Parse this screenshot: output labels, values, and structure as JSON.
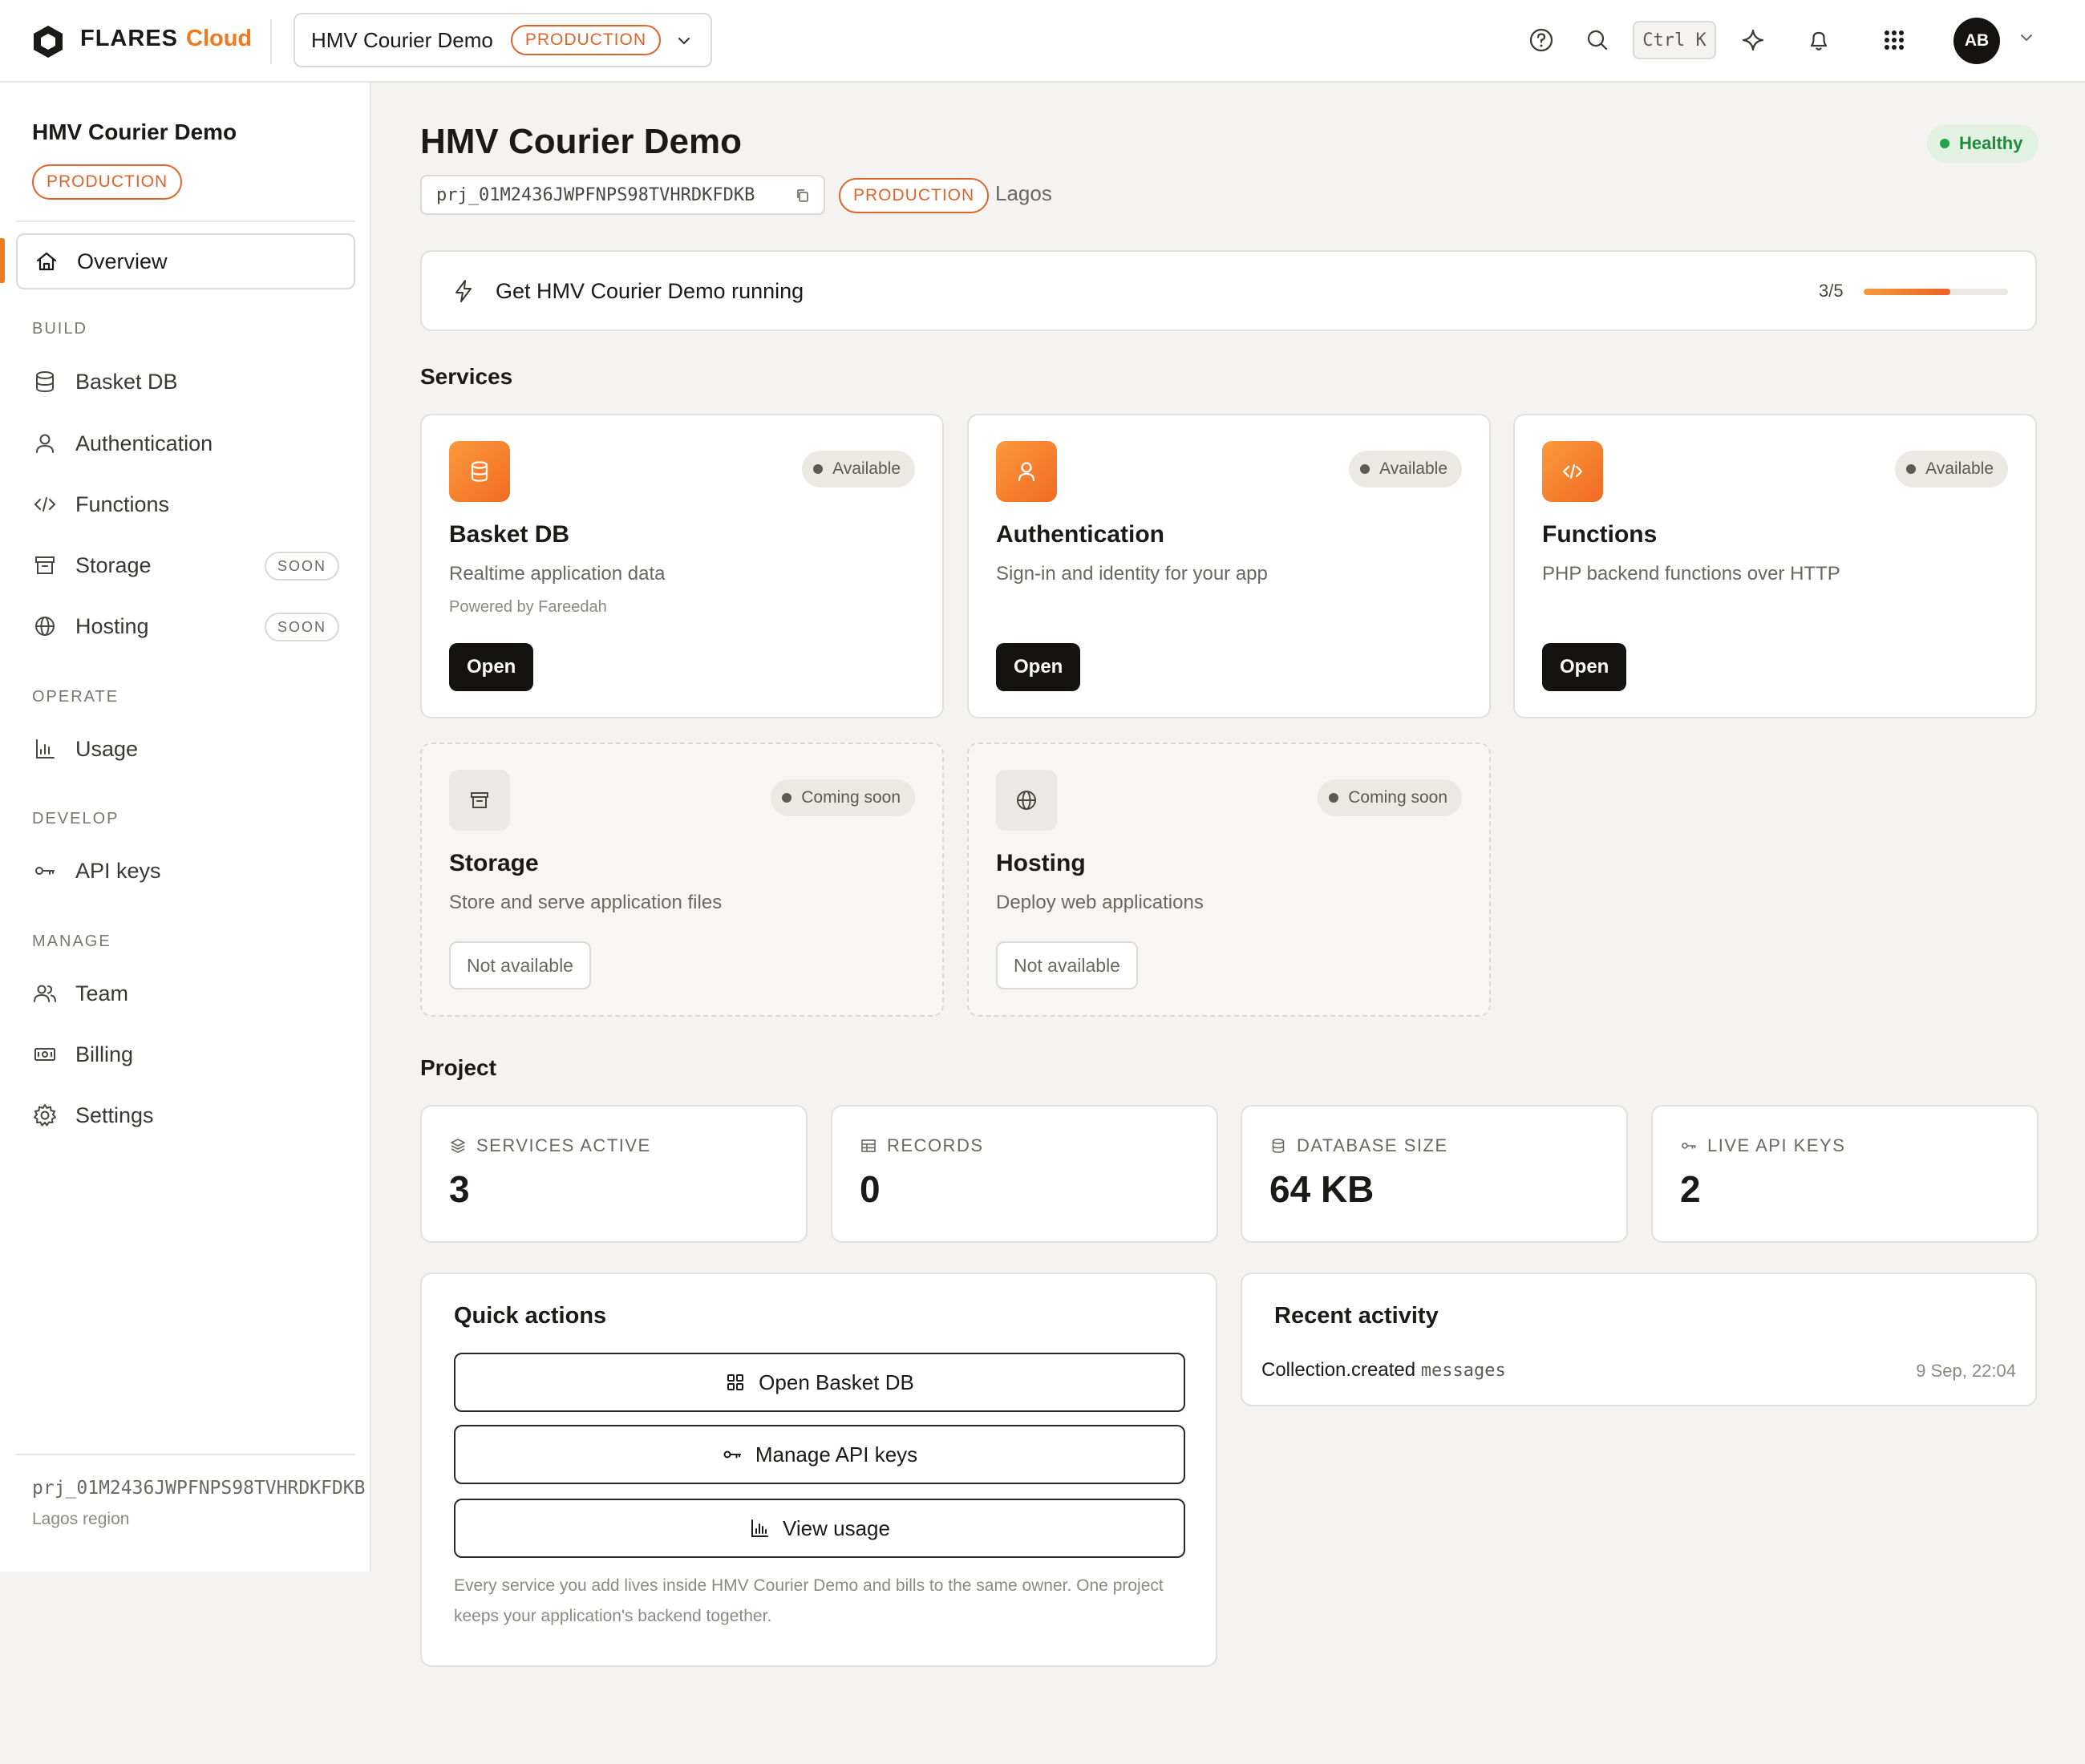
{
  "brand": {
    "name": "FLARES",
    "suffix": "Cloud",
    "accent": "#f07a1f"
  },
  "header": {
    "project_name": "HMV Courier Demo",
    "environment": "PRODUCTION",
    "shortcut": "Ctrl K",
    "avatar_initials": "AB",
    "icons": [
      "help-icon",
      "search-icon",
      "sparkle-icon",
      "bell-icon",
      "apps-grid-icon",
      "chevron-down-icon"
    ]
  },
  "sidebar": {
    "project_name": "HMV Courier Demo",
    "environment": "PRODUCTION",
    "overview_label": "Overview",
    "sections": {
      "build": "BUILD",
      "operate": "OPERATE",
      "develop": "DEVELOP",
      "manage": "MANAGE"
    },
    "items": {
      "basket_db": "Basket DB",
      "authentication": "Authentication",
      "functions": "Functions",
      "storage": "Storage",
      "hosting": "Hosting",
      "usage": "Usage",
      "api_keys": "API keys",
      "team": "Team",
      "billing": "Billing",
      "settings": "Settings"
    },
    "soon_badge": "SOON",
    "footer": {
      "project_id": "prj_01M2436JWPFNPS98TVHRDKFDKB",
      "region": "Lagos region"
    }
  },
  "main": {
    "title": "HMV Courier Demo",
    "health": "Healthy",
    "health_color": "#22a447",
    "project_id": "prj_01M2436JWPFNPS98TVHRDKFDKB",
    "environment": "PRODUCTION",
    "region": "Lagos",
    "onboarding": {
      "label": "Get HMV Courier Demo running",
      "progress_text": "3/5",
      "completed": 3,
      "total": 5
    },
    "services_heading": "Services",
    "services": [
      {
        "name": "Basket DB",
        "description": "Realtime application data",
        "powered_by": "Powered by Fareedah",
        "status": "Available",
        "action": "Open",
        "icon": "database-icon"
      },
      {
        "name": "Authentication",
        "description": "Sign-in and identity for your app",
        "status": "Available",
        "action": "Open",
        "icon": "user-icon"
      },
      {
        "name": "Functions",
        "description": "PHP backend functions over HTTP",
        "status": "Available",
        "action": "Open",
        "icon": "code-icon"
      },
      {
        "name": "Storage",
        "description": "Store and serve application files",
        "status": "Coming soon",
        "action": "Not available",
        "icon": "archive-icon"
      },
      {
        "name": "Hosting",
        "description": "Deploy web applications",
        "status": "Coming soon",
        "action": "Not available",
        "icon": "globe-icon"
      }
    ],
    "project_heading": "Project",
    "stats": [
      {
        "label": "SERVICES ACTIVE",
        "value": "3",
        "icon": "layers-icon"
      },
      {
        "label": "RECORDS",
        "value": "0",
        "icon": "table-icon"
      },
      {
        "label": "DATABASE SIZE",
        "value": "64 KB",
        "icon": "database-icon"
      },
      {
        "label": "LIVE API KEYS",
        "value": "2",
        "icon": "key-icon"
      }
    ],
    "quick_actions": {
      "title": "Quick actions",
      "buttons": [
        "Open Basket DB",
        "Manage API keys",
        "View usage"
      ],
      "note": "Every service you add lives inside HMV Courier Demo and bills to the same owner. One project keeps your application's backend together."
    },
    "recent_activity": {
      "title": "Recent activity",
      "event": "Collection.created",
      "target": "messages",
      "time": "9 Sep, 22:04"
    }
  }
}
